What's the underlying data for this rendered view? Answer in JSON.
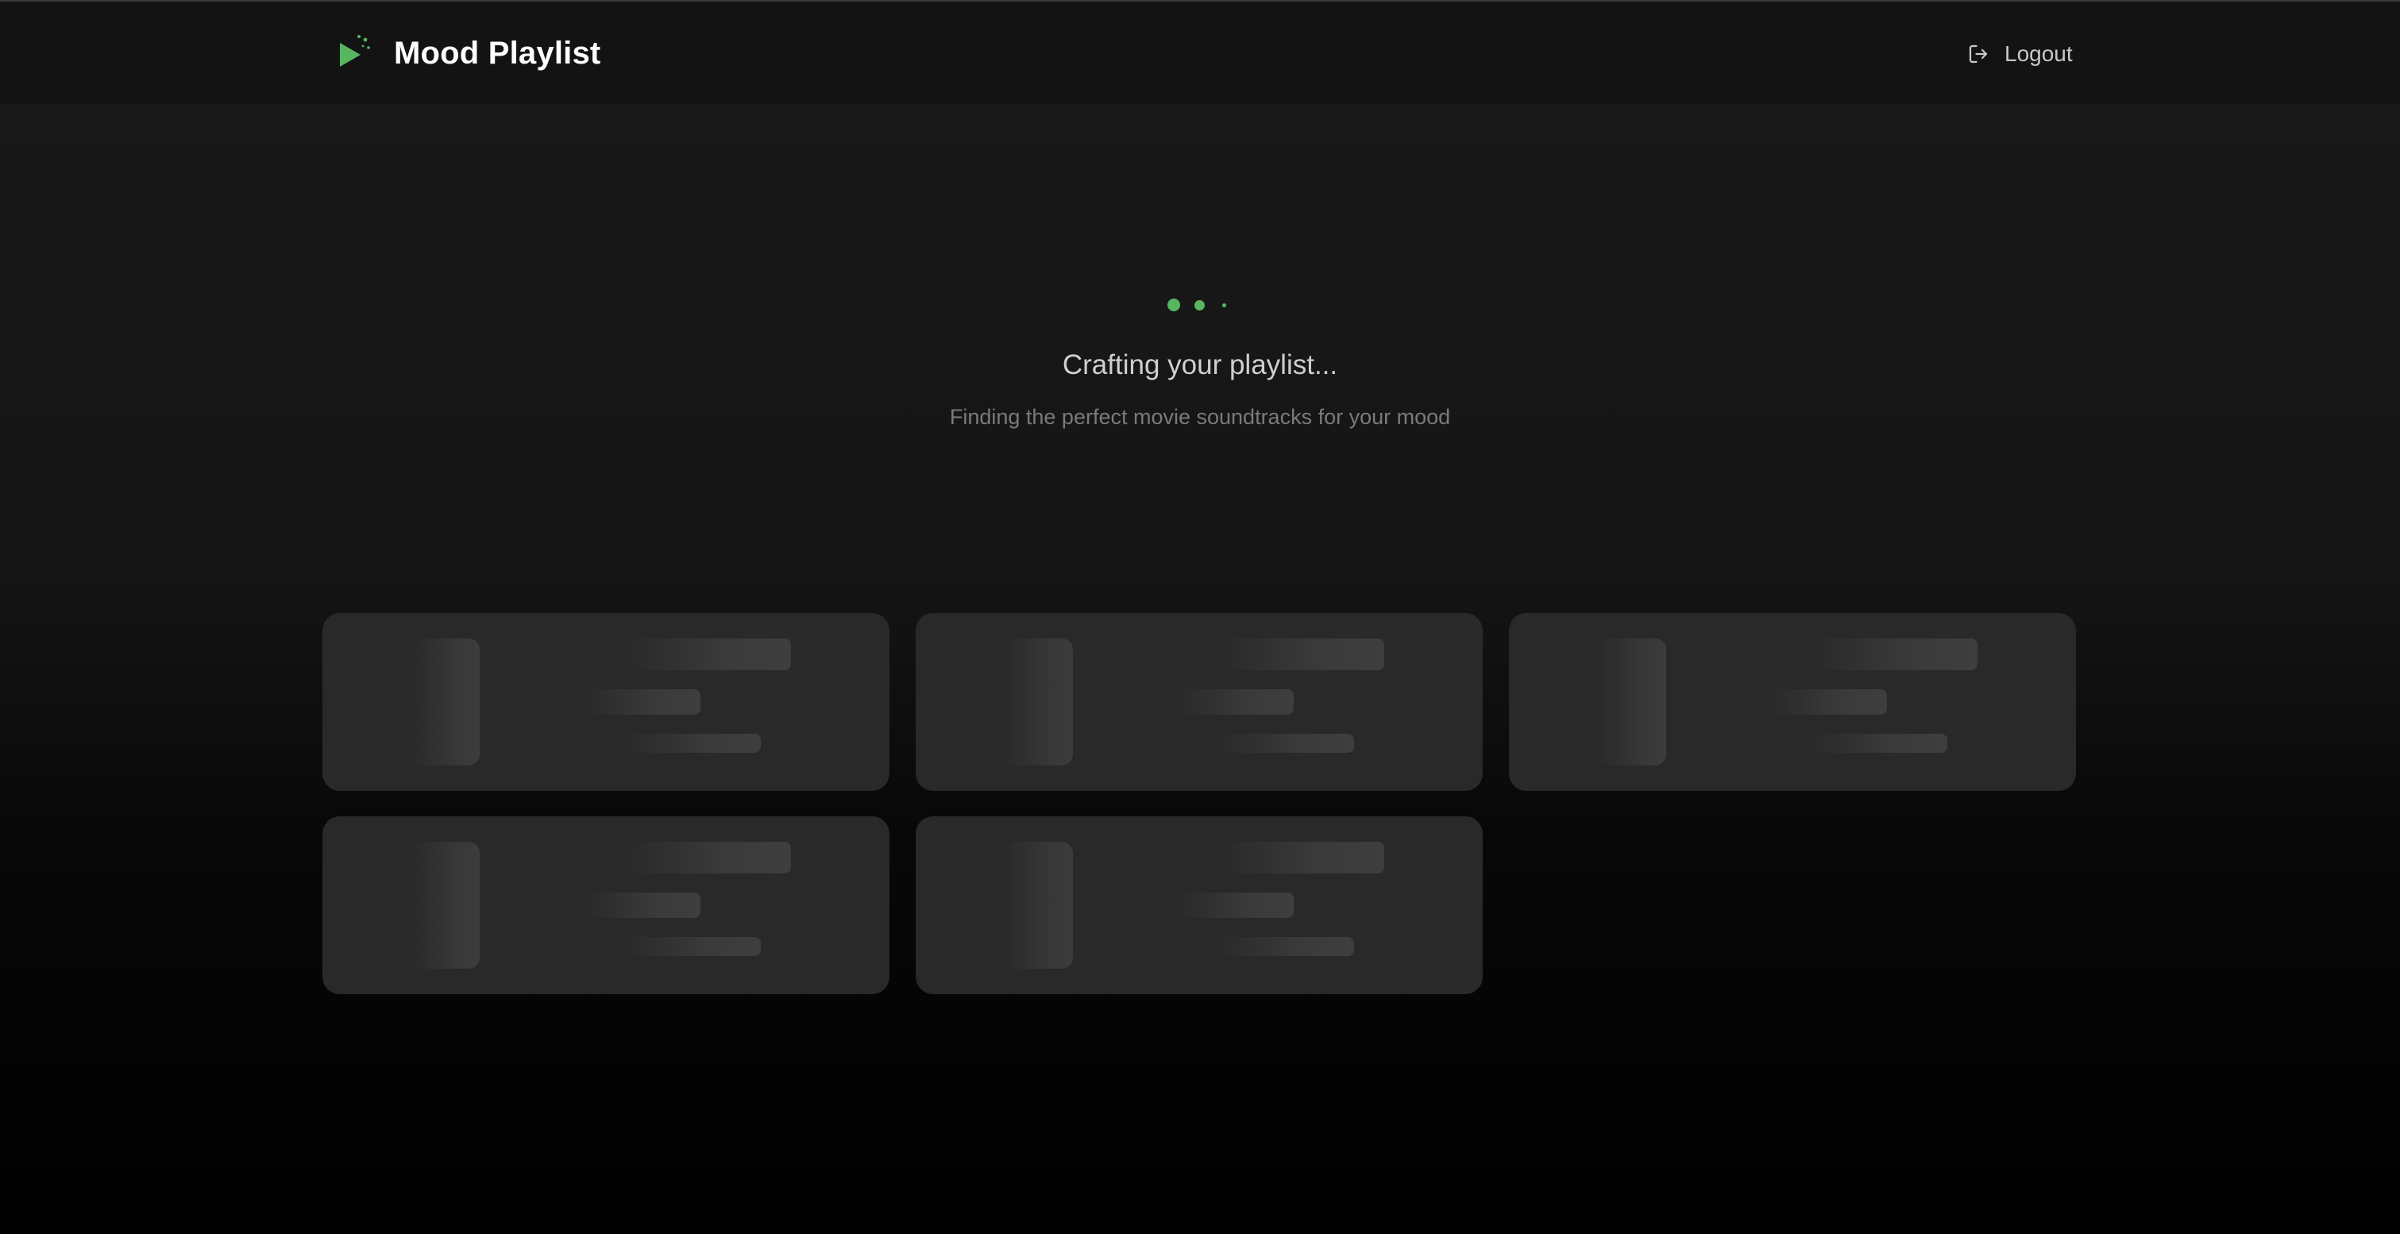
{
  "app": {
    "title": "Mood Playlist",
    "logo_icon": "play-sparkle-icon",
    "accent_color": "#57b65f"
  },
  "header": {
    "logout_label": "Logout",
    "logout_icon": "logout-icon"
  },
  "loading": {
    "title": "Crafting your playlist...",
    "subtitle": "Finding the perfect movie soundtracks for your mood"
  },
  "skeleton_cards": [
    {
      "state": "loading"
    },
    {
      "state": "loading"
    },
    {
      "state": "loading"
    },
    {
      "state": "loading"
    },
    {
      "state": "loading"
    }
  ]
}
